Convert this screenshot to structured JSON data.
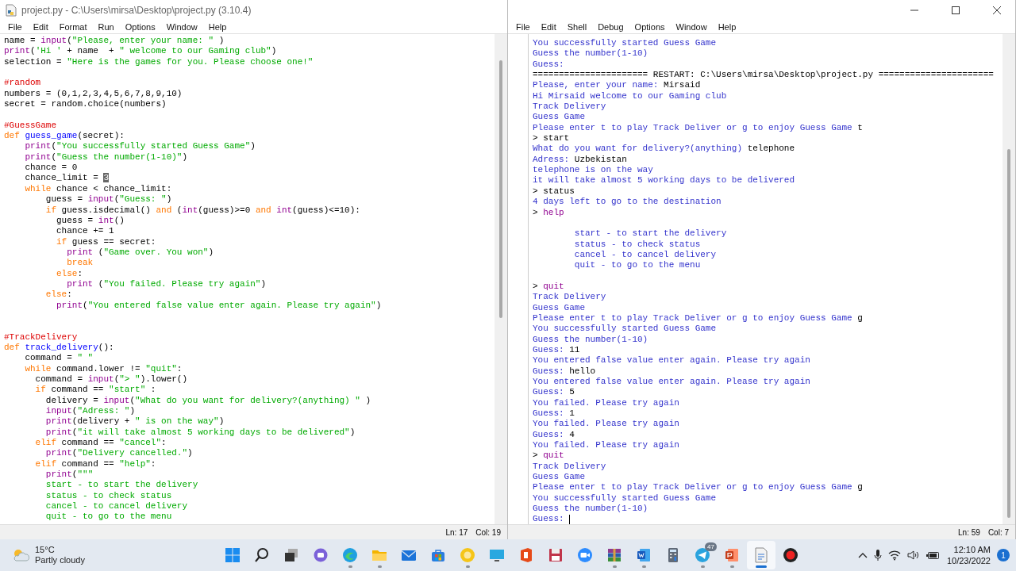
{
  "editor": {
    "title": "project.py - C:\\Users\\mirsa\\Desktop\\project.py (3.10.4)",
    "menu": [
      "File",
      "Edit",
      "Format",
      "Run",
      "Options",
      "Window",
      "Help"
    ],
    "lines": [
      {
        "kind": "code",
        "segments": [
          {
            "text": "name = ",
            "kind": "plain"
          },
          {
            "text": "input",
            "kind": "builtin"
          },
          {
            "text": "(",
            "kind": "plain"
          },
          {
            "text": "\"Please, enter your name: \"",
            "kind": "string"
          },
          {
            "text": " )",
            "kind": "plain"
          }
        ]
      },
      {
        "kind": "code",
        "segments": [
          {
            "text": "print",
            "kind": "builtin"
          },
          {
            "text": "(",
            "kind": "plain"
          },
          {
            "text": "'Hi '",
            "kind": "string"
          },
          {
            "text": " + name  + ",
            "kind": "plain"
          },
          {
            "text": "\" welcome to our Gaming club\"",
            "kind": "string"
          },
          {
            "text": ")",
            "kind": "plain"
          }
        ]
      },
      {
        "kind": "code",
        "segments": [
          {
            "text": "selection = ",
            "kind": "plain"
          },
          {
            "text": "\"Here is the games for you. Please choose one!\"",
            "kind": "string"
          }
        ]
      },
      {
        "kind": "blank"
      },
      {
        "kind": "code",
        "segments": [
          {
            "text": "#random",
            "kind": "comment"
          }
        ]
      },
      {
        "kind": "code",
        "segments": [
          {
            "text": "numbers = (0,1,2,3,4,5,6,7,8,9,10)",
            "kind": "plain"
          }
        ]
      },
      {
        "kind": "code",
        "segments": [
          {
            "text": "secret = random.choice(numbers)",
            "kind": "plain"
          }
        ]
      },
      {
        "kind": "blank"
      },
      {
        "kind": "code",
        "segments": [
          {
            "text": "#GuessGame",
            "kind": "comment"
          }
        ]
      },
      {
        "kind": "code",
        "segments": [
          {
            "text": "def ",
            "kind": "keyword"
          },
          {
            "text": "guess_game",
            "kind": "definition"
          },
          {
            "text": "(secret):",
            "kind": "plain"
          }
        ]
      },
      {
        "kind": "code",
        "segments": [
          {
            "text": "    print",
            "kind": "builtin"
          },
          {
            "text": "(",
            "kind": "plain"
          },
          {
            "text": "\"You successfully started Guess Game\"",
            "kind": "string"
          },
          {
            "text": ")",
            "kind": "plain"
          }
        ]
      },
      {
        "kind": "code",
        "segments": [
          {
            "text": "    print",
            "kind": "builtin"
          },
          {
            "text": "(",
            "kind": "plain"
          },
          {
            "text": "\"Guess the number(1-10)\"",
            "kind": "string"
          },
          {
            "text": ")",
            "kind": "plain"
          }
        ]
      },
      {
        "kind": "code",
        "segments": [
          {
            "text": "    chance = 0",
            "kind": "plain"
          }
        ]
      },
      {
        "kind": "code",
        "segments": [
          {
            "text": "    chance_limit = ",
            "kind": "plain"
          },
          {
            "text": "3",
            "kind": "selection"
          }
        ]
      },
      {
        "kind": "code",
        "segments": [
          {
            "text": "    while",
            "kind": "keyword"
          },
          {
            "text": " chance < chance_limit:",
            "kind": "plain"
          }
        ]
      },
      {
        "kind": "code",
        "segments": [
          {
            "text": "        guess = ",
            "kind": "plain"
          },
          {
            "text": "input",
            "kind": "builtin"
          },
          {
            "text": "(",
            "kind": "plain"
          },
          {
            "text": "\"Guess: \"",
            "kind": "string"
          },
          {
            "text": ")",
            "kind": "plain"
          }
        ]
      },
      {
        "kind": "code",
        "segments": [
          {
            "text": "        if",
            "kind": "keyword"
          },
          {
            "text": " guess.isdecimal() ",
            "kind": "plain"
          },
          {
            "text": "and",
            "kind": "keyword"
          },
          {
            "text": " (",
            "kind": "plain"
          },
          {
            "text": "int",
            "kind": "builtin"
          },
          {
            "text": "(guess)>=0 ",
            "kind": "plain"
          },
          {
            "text": "and ",
            "kind": "keyword"
          },
          {
            "text": "int",
            "kind": "builtin"
          },
          {
            "text": "(guess)<=10):",
            "kind": "plain"
          }
        ]
      },
      {
        "kind": "code",
        "segments": [
          {
            "text": "          guess = ",
            "kind": "plain"
          },
          {
            "text": "int",
            "kind": "builtin"
          },
          {
            "text": "()",
            "kind": "plain"
          }
        ]
      },
      {
        "kind": "code",
        "segments": [
          {
            "text": "          chance += 1",
            "kind": "plain"
          }
        ]
      },
      {
        "kind": "code",
        "segments": [
          {
            "text": "          if",
            "kind": "keyword"
          },
          {
            "text": " guess == secret:",
            "kind": "plain"
          }
        ]
      },
      {
        "kind": "code",
        "segments": [
          {
            "text": "            print",
            "kind": "builtin"
          },
          {
            "text": " (",
            "kind": "plain"
          },
          {
            "text": "\"Game over. You won\"",
            "kind": "string"
          },
          {
            "text": ")",
            "kind": "plain"
          }
        ]
      },
      {
        "kind": "code",
        "segments": [
          {
            "text": "            break",
            "kind": "keyword"
          }
        ]
      },
      {
        "kind": "code",
        "segments": [
          {
            "text": "          else",
            "kind": "keyword"
          },
          {
            "text": ":",
            "kind": "plain"
          }
        ]
      },
      {
        "kind": "code",
        "segments": [
          {
            "text": "            print",
            "kind": "builtin"
          },
          {
            "text": " (",
            "kind": "plain"
          },
          {
            "text": "\"You failed. Please try again\"",
            "kind": "string"
          },
          {
            "text": ")",
            "kind": "plain"
          }
        ]
      },
      {
        "kind": "code",
        "segments": [
          {
            "text": "        else",
            "kind": "keyword"
          },
          {
            "text": ":",
            "kind": "plain"
          }
        ]
      },
      {
        "kind": "code",
        "segments": [
          {
            "text": "          print",
            "kind": "builtin"
          },
          {
            "text": "(",
            "kind": "plain"
          },
          {
            "text": "\"You entered false value enter again. Please try again\"",
            "kind": "string"
          },
          {
            "text": ")",
            "kind": "plain"
          }
        ]
      },
      {
        "kind": "blank"
      },
      {
        "kind": "blank"
      },
      {
        "kind": "code",
        "segments": [
          {
            "text": "#TrackDelivery",
            "kind": "comment"
          }
        ]
      },
      {
        "kind": "code",
        "segments": [
          {
            "text": "def ",
            "kind": "keyword"
          },
          {
            "text": "track_delivery",
            "kind": "definition"
          },
          {
            "text": "():",
            "kind": "plain"
          }
        ]
      },
      {
        "kind": "code",
        "segments": [
          {
            "text": "    command = ",
            "kind": "plain"
          },
          {
            "text": "\" \"",
            "kind": "string"
          }
        ]
      },
      {
        "kind": "code",
        "segments": [
          {
            "text": "    while",
            "kind": "keyword"
          },
          {
            "text": " command.lower != ",
            "kind": "plain"
          },
          {
            "text": "\"quit\"",
            "kind": "string"
          },
          {
            "text": ":",
            "kind": "plain"
          }
        ]
      },
      {
        "kind": "code",
        "segments": [
          {
            "text": "      command = ",
            "kind": "plain"
          },
          {
            "text": "input",
            "kind": "builtin"
          },
          {
            "text": "(",
            "kind": "plain"
          },
          {
            "text": "\"> \"",
            "kind": "string"
          },
          {
            "text": ").lower()",
            "kind": "plain"
          }
        ]
      },
      {
        "kind": "code",
        "segments": [
          {
            "text": "      if",
            "kind": "keyword"
          },
          {
            "text": " command == ",
            "kind": "plain"
          },
          {
            "text": "\"start\"",
            "kind": "string"
          },
          {
            "text": " :",
            "kind": "plain"
          }
        ]
      },
      {
        "kind": "code",
        "segments": [
          {
            "text": "        delivery = ",
            "kind": "plain"
          },
          {
            "text": "input",
            "kind": "builtin"
          },
          {
            "text": "(",
            "kind": "plain"
          },
          {
            "text": "\"What do you want for delivery?(anything) \"",
            "kind": "string"
          },
          {
            "text": " )",
            "kind": "plain"
          }
        ]
      },
      {
        "kind": "code",
        "segments": [
          {
            "text": "        input",
            "kind": "builtin"
          },
          {
            "text": "(",
            "kind": "plain"
          },
          {
            "text": "\"Adress: \"",
            "kind": "string"
          },
          {
            "text": ")",
            "kind": "plain"
          }
        ]
      },
      {
        "kind": "code",
        "segments": [
          {
            "text": "        print",
            "kind": "builtin"
          },
          {
            "text": "(delivery + ",
            "kind": "plain"
          },
          {
            "text": "\" is on the way\"",
            "kind": "string"
          },
          {
            "text": ")",
            "kind": "plain"
          }
        ]
      },
      {
        "kind": "code",
        "segments": [
          {
            "text": "        print",
            "kind": "builtin"
          },
          {
            "text": "(",
            "kind": "plain"
          },
          {
            "text": "\"it will take almost 5 working days to be delivered\"",
            "kind": "string"
          },
          {
            "text": ")",
            "kind": "plain"
          }
        ]
      },
      {
        "kind": "code",
        "segments": [
          {
            "text": "      elif",
            "kind": "keyword"
          },
          {
            "text": " command == ",
            "kind": "plain"
          },
          {
            "text": "\"cancel\"",
            "kind": "string"
          },
          {
            "text": ":",
            "kind": "plain"
          }
        ]
      },
      {
        "kind": "code",
        "segments": [
          {
            "text": "        print",
            "kind": "builtin"
          },
          {
            "text": "(",
            "kind": "plain"
          },
          {
            "text": "\"Delivery cancelled.\"",
            "kind": "string"
          },
          {
            "text": ")",
            "kind": "plain"
          }
        ]
      },
      {
        "kind": "code",
        "segments": [
          {
            "text": "      elif",
            "kind": "keyword"
          },
          {
            "text": " command == ",
            "kind": "plain"
          },
          {
            "text": "\"help\"",
            "kind": "string"
          },
          {
            "text": ":",
            "kind": "plain"
          }
        ]
      },
      {
        "kind": "code",
        "segments": [
          {
            "text": "        print",
            "kind": "builtin"
          },
          {
            "text": "(",
            "kind": "plain"
          },
          {
            "text": "\"\"\"",
            "kind": "string"
          }
        ]
      },
      {
        "kind": "code",
        "segments": [
          {
            "text": "        start - to start the delivery",
            "kind": "string"
          }
        ]
      },
      {
        "kind": "code",
        "segments": [
          {
            "text": "        status - to check status",
            "kind": "string"
          }
        ]
      },
      {
        "kind": "code",
        "segments": [
          {
            "text": "        cancel - to cancel delivery",
            "kind": "string"
          }
        ]
      },
      {
        "kind": "code",
        "segments": [
          {
            "text": "        quit - to go to the menu",
            "kind": "string"
          }
        ]
      }
    ],
    "status": {
      "line": "Ln: 17",
      "column": "Col: 19"
    }
  },
  "shell": {
    "menu": [
      "File",
      "Edit",
      "Shell",
      "Debug",
      "Options",
      "Window",
      "Help"
    ],
    "cursor_visible": true,
    "lines": [
      {
        "kind": "code",
        "segments": [
          {
            "text": "You successfully started Guess Game",
            "kind": "output"
          }
        ]
      },
      {
        "kind": "code",
        "segments": [
          {
            "text": "Guess the number(1-10)",
            "kind": "output"
          }
        ]
      },
      {
        "kind": "code",
        "segments": [
          {
            "text": "Guess:",
            "kind": "output"
          }
        ]
      },
      {
        "kind": "code",
        "segments": [
          {
            "text": "====================== RESTART: C:\\Users\\mirsa\\Desktop\\project.py ======================",
            "kind": "plain"
          }
        ]
      },
      {
        "kind": "code",
        "segments": [
          {
            "text": "Please, enter your name: ",
            "kind": "output"
          },
          {
            "text": "Mirsaid",
            "kind": "plain"
          }
        ]
      },
      {
        "kind": "code",
        "segments": [
          {
            "text": "Hi Mirsaid welcome to our Gaming club",
            "kind": "output"
          }
        ]
      },
      {
        "kind": "code",
        "segments": [
          {
            "text": "Track Delivery",
            "kind": "output"
          }
        ]
      },
      {
        "kind": "code",
        "segments": [
          {
            "text": "Guess Game",
            "kind": "output"
          }
        ]
      },
      {
        "kind": "code",
        "segments": [
          {
            "text": "Please enter t to play Track Deliver or g to enjoy Guess Game ",
            "kind": "output"
          },
          {
            "text": "t",
            "kind": "plain"
          }
        ]
      },
      {
        "kind": "code",
        "segments": [
          {
            "text": "> start",
            "kind": "plain"
          }
        ]
      },
      {
        "kind": "code",
        "segments": [
          {
            "text": "What do you want for delivery?(anything) ",
            "kind": "output"
          },
          {
            "text": "telephone",
            "kind": "plain"
          }
        ]
      },
      {
        "kind": "code",
        "segments": [
          {
            "text": "Adress: ",
            "kind": "output"
          },
          {
            "text": "Uzbekistan",
            "kind": "plain"
          }
        ]
      },
      {
        "kind": "code",
        "segments": [
          {
            "text": "telephone is on the way",
            "kind": "output"
          }
        ]
      },
      {
        "kind": "code",
        "segments": [
          {
            "text": "it will take almost 5 working days to be delivered",
            "kind": "output"
          }
        ]
      },
      {
        "kind": "code",
        "segments": [
          {
            "text": "> status",
            "kind": "plain"
          }
        ]
      },
      {
        "kind": "code",
        "segments": [
          {
            "text": "4 days left to go to the destination",
            "kind": "output"
          }
        ]
      },
      {
        "kind": "code",
        "segments": [
          {
            "text": "> ",
            "kind": "plain"
          },
          {
            "text": "help",
            "kind": "builtin"
          }
        ]
      },
      {
        "kind": "blank"
      },
      {
        "kind": "code",
        "segments": [
          {
            "text": "        start - to start the delivery",
            "kind": "output"
          }
        ]
      },
      {
        "kind": "code",
        "segments": [
          {
            "text": "        status - to check status",
            "kind": "output"
          }
        ]
      },
      {
        "kind": "code",
        "segments": [
          {
            "text": "        cancel - to cancel delivery",
            "kind": "output"
          }
        ]
      },
      {
        "kind": "code",
        "segments": [
          {
            "text": "        quit - to go to the menu",
            "kind": "output"
          }
        ]
      },
      {
        "kind": "blank"
      },
      {
        "kind": "code",
        "segments": [
          {
            "text": "> ",
            "kind": "plain"
          },
          {
            "text": "quit",
            "kind": "builtin"
          }
        ]
      },
      {
        "kind": "code",
        "segments": [
          {
            "text": "Track Delivery",
            "kind": "output"
          }
        ]
      },
      {
        "kind": "code",
        "segments": [
          {
            "text": "Guess Game",
            "kind": "output"
          }
        ]
      },
      {
        "kind": "code",
        "segments": [
          {
            "text": "Please enter t to play Track Deliver or g to enjoy Guess Game ",
            "kind": "output"
          },
          {
            "text": "g",
            "kind": "plain"
          }
        ]
      },
      {
        "kind": "code",
        "segments": [
          {
            "text": "You successfully started Guess Game",
            "kind": "output"
          }
        ]
      },
      {
        "kind": "code",
        "segments": [
          {
            "text": "Guess the number(1-10)",
            "kind": "output"
          }
        ]
      },
      {
        "kind": "code",
        "segments": [
          {
            "text": "Guess: ",
            "kind": "output"
          },
          {
            "text": "11",
            "kind": "plain"
          }
        ]
      },
      {
        "kind": "code",
        "segments": [
          {
            "text": "You entered false value enter again. Please try again",
            "kind": "output"
          }
        ]
      },
      {
        "kind": "code",
        "segments": [
          {
            "text": "Guess: ",
            "kind": "output"
          },
          {
            "text": "hello",
            "kind": "plain"
          }
        ]
      },
      {
        "kind": "code",
        "segments": [
          {
            "text": "You entered false value enter again. Please try again",
            "kind": "output"
          }
        ]
      },
      {
        "kind": "code",
        "segments": [
          {
            "text": "Guess: ",
            "kind": "output"
          },
          {
            "text": "5",
            "kind": "plain"
          }
        ]
      },
      {
        "kind": "code",
        "segments": [
          {
            "text": "You failed. Please try again",
            "kind": "output"
          }
        ]
      },
      {
        "kind": "code",
        "segments": [
          {
            "text": "Guess: ",
            "kind": "output"
          },
          {
            "text": "1",
            "kind": "plain"
          }
        ]
      },
      {
        "kind": "code",
        "segments": [
          {
            "text": "You failed. Please try again",
            "kind": "output"
          }
        ]
      },
      {
        "kind": "code",
        "segments": [
          {
            "text": "Guess: ",
            "kind": "output"
          },
          {
            "text": "4",
            "kind": "plain"
          }
        ]
      },
      {
        "kind": "code",
        "segments": [
          {
            "text": "You failed. Please try again",
            "kind": "output"
          }
        ]
      },
      {
        "kind": "code",
        "segments": [
          {
            "text": "> ",
            "kind": "plain"
          },
          {
            "text": "quit",
            "kind": "builtin"
          }
        ]
      },
      {
        "kind": "code",
        "segments": [
          {
            "text": "Track Delivery",
            "kind": "output"
          }
        ]
      },
      {
        "kind": "code",
        "segments": [
          {
            "text": "Guess Game",
            "kind": "output"
          }
        ]
      },
      {
        "kind": "code",
        "segments": [
          {
            "text": "Please enter t to play Track Deliver or g to enjoy Guess Game ",
            "kind": "output"
          },
          {
            "text": "g",
            "kind": "plain"
          }
        ]
      },
      {
        "kind": "code",
        "segments": [
          {
            "text": "You successfully started Guess Game",
            "kind": "output"
          }
        ]
      },
      {
        "kind": "code",
        "segments": [
          {
            "text": "Guess the number(1-10)",
            "kind": "output"
          }
        ]
      },
      {
        "kind": "code",
        "segments": [
          {
            "text": "Guess: ",
            "kind": "output"
          }
        ]
      }
    ],
    "status": {
      "line": "Ln: 59",
      "column": "Col: 7"
    }
  },
  "taskbar": {
    "weather": {
      "temperature": "15°C",
      "condition": "Partly cloudy"
    },
    "apps": [
      {
        "kind": "start",
        "running": false,
        "selected": false
      },
      {
        "kind": "search",
        "running": false,
        "selected": false
      },
      {
        "kind": "taskview",
        "running": false,
        "selected": false
      },
      {
        "kind": "chat",
        "running": false,
        "selected": false
      },
      {
        "kind": "browser",
        "running": true,
        "selected": false
      },
      {
        "kind": "folder",
        "running": true,
        "selected": false
      },
      {
        "kind": "mail",
        "running": false,
        "selected": false
      },
      {
        "kind": "store",
        "running": false,
        "selected": false
      },
      {
        "kind": "circle",
        "running": true,
        "selected": false
      },
      {
        "kind": "monitor",
        "running": false,
        "selected": false
      },
      {
        "kind": "office",
        "running": false,
        "selected": false
      },
      {
        "kind": "floppy",
        "running": false,
        "selected": false
      },
      {
        "kind": "camera",
        "running": false,
        "selected": false
      },
      {
        "kind": "archive",
        "running": true,
        "selected": false
      },
      {
        "kind": "word",
        "running": true,
        "selected": false
      },
      {
        "kind": "calculator",
        "running": false,
        "selected": false
      },
      {
        "kind": "telegram",
        "running": true,
        "selected": false,
        "badge": "47"
      },
      {
        "kind": "slides",
        "running": true,
        "selected": false
      },
      {
        "kind": "notepad",
        "running": true,
        "selected": true
      },
      {
        "kind": "record",
        "running": false,
        "selected": false
      }
    ],
    "time": "12:10 AM",
    "date": "10/23/2022",
    "notifications": "1"
  }
}
